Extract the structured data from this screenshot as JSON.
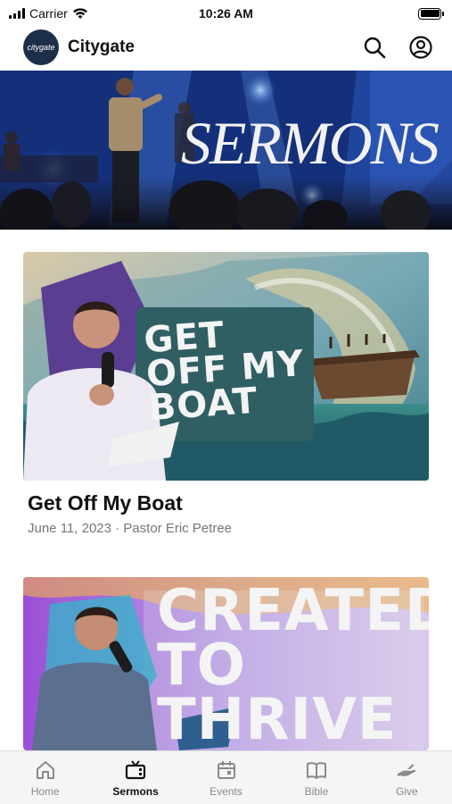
{
  "status_bar": {
    "carrier": "Carrier",
    "time": "10:26 AM",
    "battery_level": 1.0
  },
  "header": {
    "logo_text": "citygate",
    "title": "Citygate",
    "icons": [
      "search-icon",
      "account-icon"
    ]
  },
  "hero": {
    "title": "SERMONS"
  },
  "sermons": [
    {
      "art_text": "GET OFF MY BOAT",
      "title": "Get Off My Boat",
      "meta": "June 11, 2023 · Pastor Eric Petree"
    },
    {
      "art_text": "CREATED TO THRIVE",
      "title": "",
      "meta": ""
    }
  ],
  "tab_bar": {
    "tabs": [
      {
        "label": "Home",
        "icon": "home-icon",
        "active": false
      },
      {
        "label": "Sermons",
        "icon": "tv-icon",
        "active": true
      },
      {
        "label": "Events",
        "icon": "calendar-icon",
        "active": false
      },
      {
        "label": "Bible",
        "icon": "book-icon",
        "active": false
      },
      {
        "label": "Give",
        "icon": "give-hand-icon",
        "active": false
      }
    ]
  },
  "colors": {
    "logo_bg": "#1d2e49",
    "hero_blue": "#1a3d8f",
    "tab_active": "#111111",
    "tab_inactive": "#8a8a8a"
  }
}
